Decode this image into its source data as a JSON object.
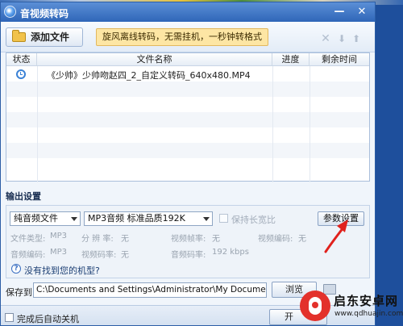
{
  "window": {
    "title": "音视频转码",
    "minimize_symbol": "—",
    "close_symbol": "✕"
  },
  "toolbar": {
    "add_file_label": "添加文件",
    "promo_text": "旋风离线转码，无需挂机，一秒钟转格式"
  },
  "file_list": {
    "columns": [
      "状态",
      "文件名称",
      "进度",
      "剩余时间"
    ],
    "rows": [
      {
        "status_icon": "clock-icon",
        "name": "《少帅》少帅吻赵四_2_自定义转码_640x480.MP4",
        "progress": "",
        "remaining": ""
      }
    ]
  },
  "output_settings": {
    "section_title": "输出设置",
    "file_type": "纯音频文件",
    "quality": "MP3音频 标准品质192K",
    "keep_ratio_label": "保持长宽比",
    "param_button_label": "参数设置",
    "info": {
      "file_type_label": "文件类型:",
      "file_type_value": "MP3",
      "resolution_label": "分 辨 率:",
      "resolution_value": "无",
      "video_fps_label": "视频帧率:",
      "video_fps_value": "无",
      "video_codec_label": "视频编码:",
      "video_codec_value": "无",
      "audio_codec_label": "音频编码:",
      "audio_codec_value": "MP3",
      "video_bitrate_label": "视频码率:",
      "video_bitrate_value": "无",
      "audio_bitrate_label": "音频码率:",
      "audio_bitrate_value": "192 kbps"
    },
    "help_link": "没有找到您的机型?"
  },
  "save_to": {
    "label": "保存到:",
    "path": "C:\\Documents and Settings\\Administrator\\My Documents\\My Vide",
    "browse_label": "浏览"
  },
  "bottom": {
    "shutdown_label": "完成后自动关机",
    "start_label": "开"
  },
  "watermark": {
    "brand": "启东安卓网",
    "url": "www.qdhuajin.com"
  },
  "colors": {
    "titlebar": "#2f66b8",
    "promo_bg": "#fde6a4",
    "annotation_arrow": "#e0211d"
  }
}
